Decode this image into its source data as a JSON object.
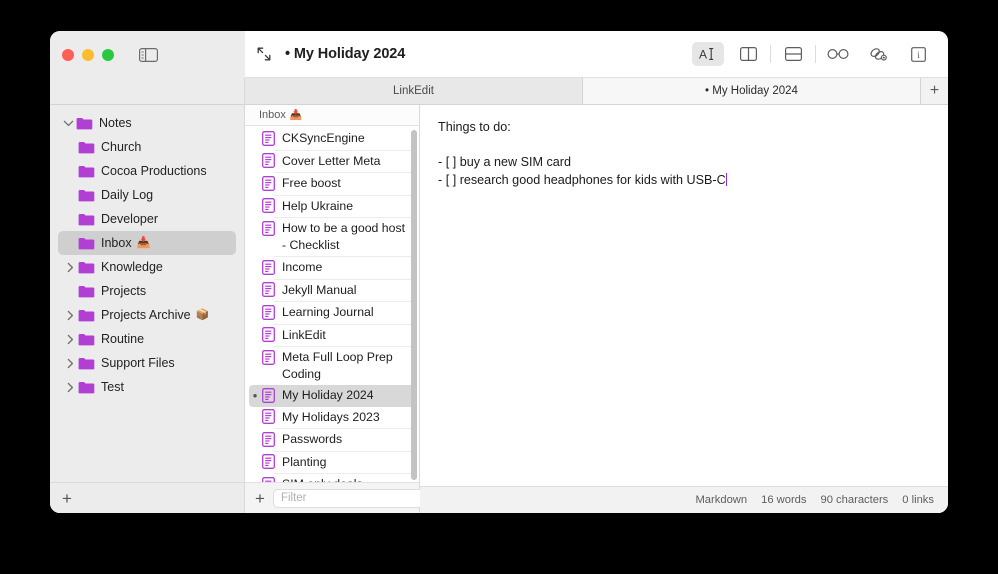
{
  "window": {
    "doc_title": "• My Holiday 2024",
    "traffic_lights": [
      "close",
      "minimize",
      "zoom"
    ],
    "colors": {
      "accent_purple": "#b23fd4",
      "caret": "#8b2fd6",
      "close": "#ff5f57",
      "minimize": "#febc2e",
      "zoom": "#28c840",
      "selection": "#cfcfcf"
    }
  },
  "toolbar": {
    "sidebar_toggle": "sidebar-toggle-icon",
    "expand_icon": "expand-collapse-icon",
    "buttons": [
      {
        "name": "text-format",
        "icon": "A-text-cursor-icon",
        "active": true
      },
      {
        "name": "split-vertical",
        "icon": "split-vertical-icon",
        "active": false
      },
      {
        "name": "split-horizontal",
        "icon": "split-horizontal-icon",
        "active": false
      },
      {
        "name": "preview-glasses",
        "icon": "glasses-icon",
        "active": false
      },
      {
        "name": "links",
        "icon": "link-chain-gear-icon",
        "active": false
      },
      {
        "name": "info",
        "icon": "info-icon",
        "active": false
      }
    ]
  },
  "tabs": {
    "items": [
      {
        "label": "LinkEdit",
        "active": false
      },
      {
        "label": "• My Holiday 2024",
        "active": true
      }
    ],
    "add_label": "+"
  },
  "sidebar": {
    "items": [
      {
        "label": "Notes",
        "level": 0,
        "disclosure": "expanded",
        "emoji": "",
        "selected": false
      },
      {
        "label": "Church",
        "level": 1,
        "disclosure": "none",
        "emoji": "",
        "selected": false
      },
      {
        "label": "Cocoa Productions",
        "level": 1,
        "disclosure": "none",
        "emoji": "",
        "selected": false
      },
      {
        "label": "Daily Log",
        "level": 1,
        "disclosure": "none",
        "emoji": "",
        "selected": false
      },
      {
        "label": "Developer",
        "level": 1,
        "disclosure": "none",
        "emoji": "",
        "selected": false
      },
      {
        "label": "Inbox",
        "level": 1,
        "disclosure": "none",
        "emoji": "📥",
        "selected": true
      },
      {
        "label": "Knowledge",
        "level": 1,
        "disclosure": "collapsed",
        "emoji": "",
        "selected": false
      },
      {
        "label": "Projects",
        "level": 1,
        "disclosure": "none",
        "emoji": "",
        "selected": false
      },
      {
        "label": "Projects Archive",
        "level": 1,
        "disclosure": "collapsed",
        "emoji": "📦",
        "selected": false
      },
      {
        "label": "Routine",
        "level": 1,
        "disclosure": "collapsed",
        "emoji": "",
        "selected": false
      },
      {
        "label": "Support Files",
        "level": 1,
        "disclosure": "collapsed",
        "emoji": "",
        "selected": false
      },
      {
        "label": "Test",
        "level": 1,
        "disclosure": "collapsed",
        "emoji": "",
        "selected": false
      }
    ],
    "add_button_label": "+"
  },
  "notelist": {
    "header_label": "Inbox",
    "header_emoji": "📥",
    "notes": [
      {
        "title": "CKSyncEngine",
        "selected": false,
        "dot": false
      },
      {
        "title": "Cover Letter Meta",
        "selected": false,
        "dot": false
      },
      {
        "title": "Free boost",
        "selected": false,
        "dot": false
      },
      {
        "title": "Help Ukraine",
        "selected": false,
        "dot": false
      },
      {
        "title": "How to be a good host - Checklist",
        "selected": false,
        "dot": false
      },
      {
        "title": "Income",
        "selected": false,
        "dot": false
      },
      {
        "title": "Jekyll Manual",
        "selected": false,
        "dot": false
      },
      {
        "title": "Learning Journal",
        "selected": false,
        "dot": false
      },
      {
        "title": "LinkEdit",
        "selected": false,
        "dot": false
      },
      {
        "title": "Meta Full Loop Prep Coding",
        "selected": false,
        "dot": false
      },
      {
        "title": "My Holiday 2024",
        "selected": true,
        "dot": true
      },
      {
        "title": "My Holidays 2023",
        "selected": false,
        "dot": false
      },
      {
        "title": "Passwords",
        "selected": false,
        "dot": false
      },
      {
        "title": "Planting",
        "selected": false,
        "dot": false
      },
      {
        "title": "SIM only deals",
        "selected": false,
        "dot": false
      }
    ],
    "add_button_label": "+",
    "filter_placeholder": "Filter",
    "filter_value": ""
  },
  "editor": {
    "lines": [
      "Things to do:",
      "",
      "- [ ] buy a new SIM card",
      "- [ ] research good headphones for kids with USB-C"
    ],
    "caret_line_index": 3
  },
  "statusbar": {
    "syntax": "Markdown",
    "words": "16 words",
    "characters": "90 characters",
    "links": "0 links"
  }
}
